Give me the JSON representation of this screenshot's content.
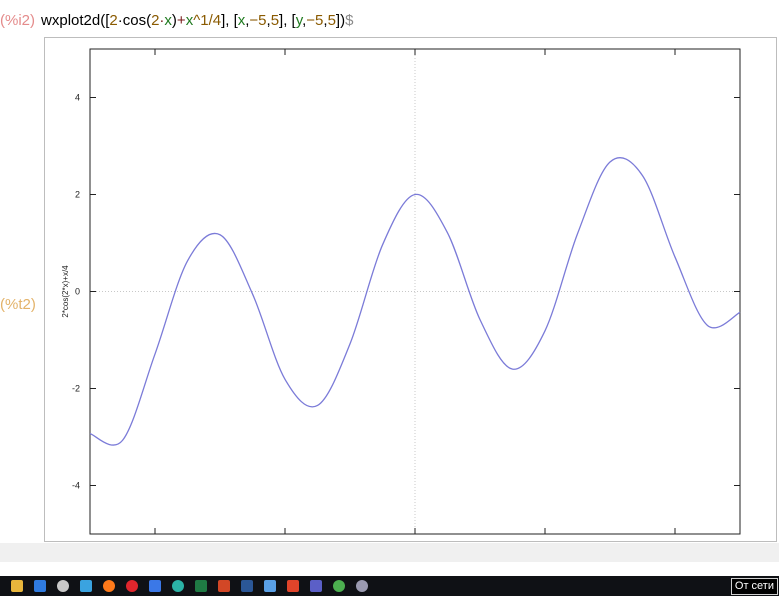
{
  "input_cell": {
    "label": "(%i2)",
    "command_parts": [
      {
        "t": "wxplot2d([",
        "c": "cmd"
      },
      {
        "t": "2",
        "c": "num"
      },
      {
        "t": "·cos(",
        "c": "cmd"
      },
      {
        "t": "2",
        "c": "num"
      },
      {
        "t": "·",
        "c": "op"
      },
      {
        "t": "x",
        "c": "var"
      },
      {
        "t": ")",
        "c": "cmd"
      },
      {
        "t": "+",
        "c": "op"
      },
      {
        "t": "x",
        "c": "var"
      },
      {
        "t": "^1/4",
        "c": "num"
      },
      {
        "t": "], [",
        "c": "cmd"
      },
      {
        "t": "x",
        "c": "var"
      },
      {
        "t": ",",
        "c": "cmd"
      },
      {
        "t": "−5",
        "c": "num"
      },
      {
        "t": ",",
        "c": "cmd"
      },
      {
        "t": "5",
        "c": "num"
      },
      {
        "t": "], [",
        "c": "cmd"
      },
      {
        "t": "y",
        "c": "var"
      },
      {
        "t": ",",
        "c": "cmd"
      },
      {
        "t": "−5",
        "c": "num"
      },
      {
        "t": ",",
        "c": "cmd"
      },
      {
        "t": "5",
        "c": "num"
      },
      {
        "t": "])",
        "c": "cmd"
      },
      {
        "t": "$",
        "c": "dollar"
      }
    ]
  },
  "output_cell": {
    "label": "(%t2)"
  },
  "chart_data": {
    "type": "line",
    "ylabel": "2*cos(2*x)+x/4",
    "xlim": [
      -5,
      5
    ],
    "ylim": [
      -5,
      5
    ],
    "x_ticks": [
      -4,
      -2,
      0,
      2,
      4
    ],
    "y_ticks": [
      4,
      2,
      0,
      -2,
      -4
    ],
    "y_tick_labels": [
      "4",
      "2",
      "0",
      "-2",
      "-4"
    ],
    "grid": false,
    "zero_axes": true,
    "series": [
      {
        "color": "#7b7bd8",
        "x": [
          -5,
          -4.5,
          -4,
          -3.5,
          -3,
          -2.5,
          -2,
          -1.5,
          -1,
          -0.5,
          0,
          0.5,
          1,
          1.5,
          2,
          2.5,
          3,
          3.5,
          4,
          4.5,
          5
        ],
        "y": [
          -2.93,
          -3.07,
          -1.29,
          0.63,
          1.17,
          -0.05,
          -1.81,
          -2.35,
          -1.08,
          0.96,
          2.0,
          1.21,
          -0.58,
          -1.6,
          -0.81,
          1.19,
          2.67,
          2.39,
          0.71,
          -0.7,
          -0.43
        ]
      }
    ]
  },
  "taskbar": {
    "icons": [
      {
        "name": "file-explorer",
        "color": "#e8b63c"
      },
      {
        "name": "mail",
        "color": "#2f7be0"
      },
      {
        "name": "settings",
        "color": "#c8c8c8"
      },
      {
        "name": "media-player",
        "color": "#3aa3e0"
      },
      {
        "name": "firefox",
        "color": "#ff7a1a"
      },
      {
        "name": "opera",
        "color": "#e0262d"
      },
      {
        "name": "photos",
        "color": "#3b78e7"
      },
      {
        "name": "edge",
        "color": "#2bb3a6"
      },
      {
        "name": "excel",
        "color": "#1f7a44"
      },
      {
        "name": "powerpoint",
        "color": "#d24726"
      },
      {
        "name": "word",
        "color": "#2b5797"
      },
      {
        "name": "store",
        "color": "#5aa0e6"
      },
      {
        "name": "office",
        "color": "#e0442a"
      },
      {
        "name": "teams",
        "color": "#5b5fc7"
      },
      {
        "name": "chrome",
        "color": "#4caf50"
      },
      {
        "name": "maxima",
        "color": "#9a9ab0"
      }
    ],
    "status_text": "От сети"
  }
}
